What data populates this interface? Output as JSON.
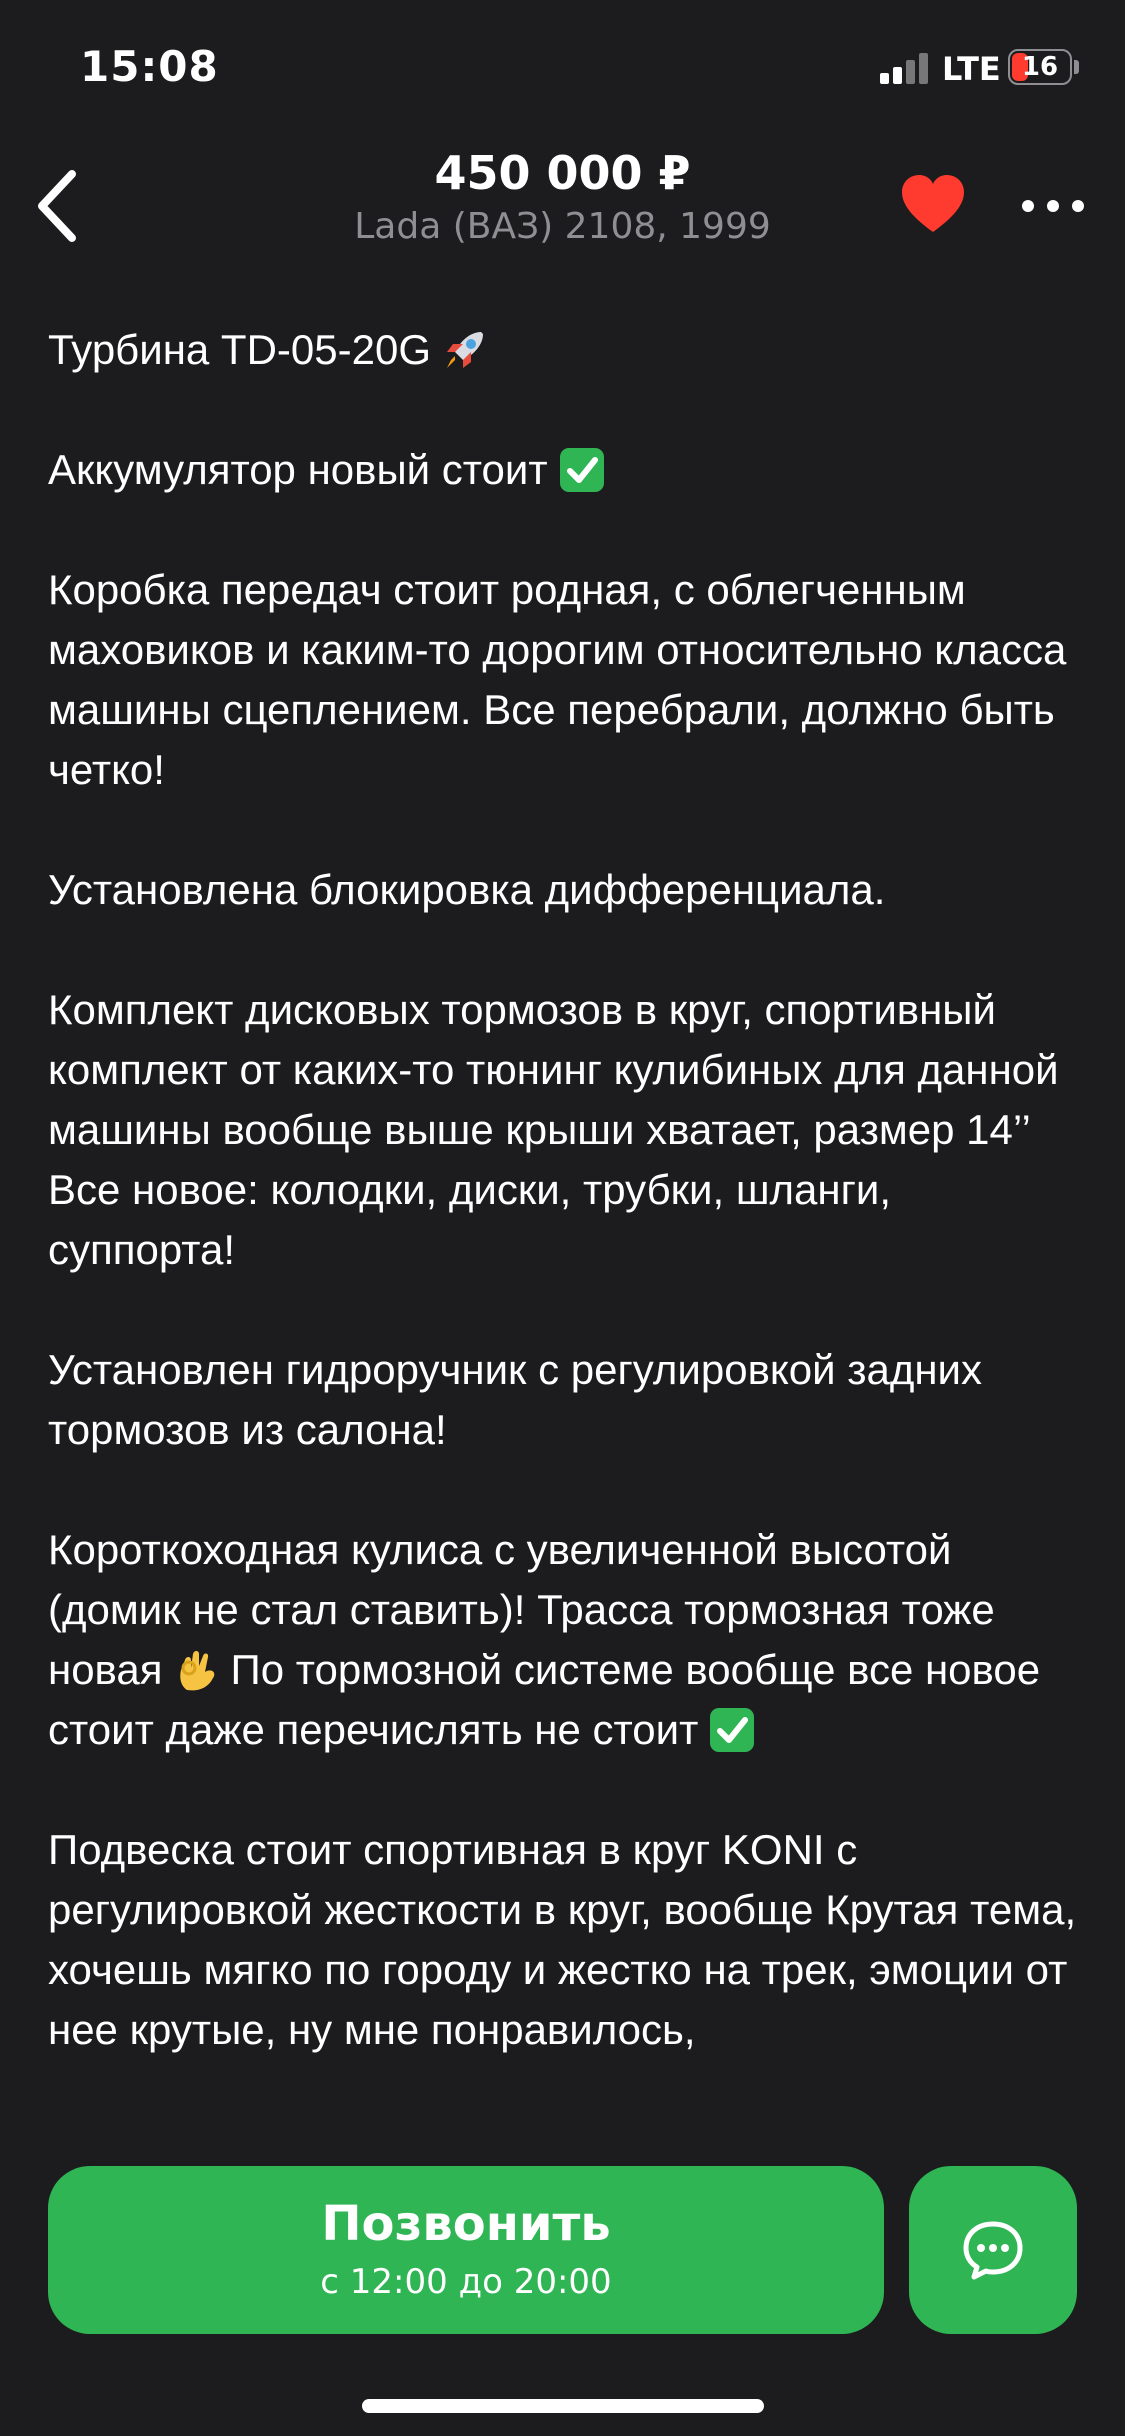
{
  "status_bar": {
    "time": "15:08",
    "network": "LTE",
    "battery": "16"
  },
  "header": {
    "price": "450 000 ₽",
    "subtitle": "Lada (ВАЗ) 2108, 1999"
  },
  "description": {
    "p1": "Турбина TD-05-20G",
    "p2": "Аккумулятор новый стоит",
    "p3": "Коробка передач стоит родная, с облегченным маховиков и каким-то дорогим относительно класса машины сцеплением. Все перебрали, должно быть четко!",
    "p4": "Установлена блокировка дифференциала.",
    "p5a": "Комплект дисковых тормозов в круг, спортивный комплект от каких-то тюнинг кулибиных для данной машины вообще выше крыши хватает, размер 14’’",
    "p5b": "Все новое: колодки, диски, трубки, шланги, суппорта!",
    "p6": "Установлен гидроручник с регулировкой задних тормозов из салона!",
    "p7a": "Короткоходная кулиса с увеличенной высотой (домик не стал ставить)! Трасса тормозная тоже новая",
    "p7b": "По тормозной системе вообще все новое стоит даже перечислять не стоит",
    "p8": "Подвеска стоит спортивная в круг KONI с регулировкой жесткости в круг, вообще Крутая тема, хочешь мягко по городу и жестко на трек, эмоции от нее крутые, ну мне понравилось,"
  },
  "actions": {
    "call_label": "Позвонить",
    "call_hours": "с 12:00 до 20:00"
  },
  "colors": {
    "background": "#1c1c1e",
    "accent_green": "#2fb554",
    "heart_red": "#ff3b30",
    "secondary_text": "#8e8e93"
  },
  "icons": {
    "back": "chevron-left-icon",
    "favorite": "heart-icon",
    "more": "more-dots-icon",
    "chat": "chat-bubble-icon",
    "rocket": "rocket-emoji",
    "check": "check-mark-emoji",
    "ok_hand": "ok-hand-emoji"
  }
}
